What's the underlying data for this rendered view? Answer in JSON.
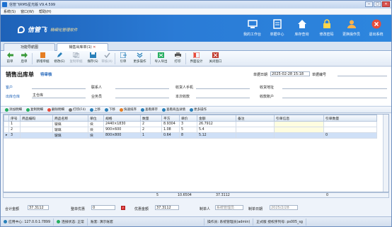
{
  "window": {
    "title": "信管飞RMS星光版 V9.4.599",
    "controls": [
      "─",
      "□",
      "✕"
    ]
  },
  "menu": [
    "系统(S)",
    "窗口(W)",
    "帮助(H)"
  ],
  "brand": {
    "name": "信管飞",
    "slogan": "精细化管理软件"
  },
  "topnav": [
    {
      "label": "我的工作台",
      "icon": "desk-icon",
      "color": "#ffffff"
    },
    {
      "label": "单据中心",
      "icon": "document-icon",
      "color": "#ffffff"
    },
    {
      "label": "库存查询",
      "icon": "home-icon",
      "color": "#ffffff"
    },
    {
      "label": "修改密码",
      "icon": "lock-icon",
      "color": "#ffd54a"
    },
    {
      "label": "更换操作员",
      "icon": "user-icon",
      "color": "#ffb24a"
    },
    {
      "label": "退出系统",
      "icon": "power-icon",
      "color": "#e74c3c"
    }
  ],
  "tabs": [
    {
      "label": "功能导航图"
    },
    {
      "label": "销售出库单(1)",
      "close": "✕"
    }
  ],
  "toolbar": [
    {
      "label": "前单",
      "icon": "arrow-left-icon",
      "color": "#3a9a3a",
      "disabled": false
    },
    {
      "label": "后单",
      "icon": "arrow-right-icon",
      "color": "#3a9a3a",
      "disabled": false
    },
    {
      "label": "新增单据",
      "icon": "new-icon",
      "color": "#e67e22",
      "disabled": false
    },
    {
      "label": "修改(E)",
      "icon": "edit-icon",
      "color": "#2980b9",
      "disabled": false
    },
    {
      "label": "复制单据",
      "icon": "copy-icon",
      "color": "#9aa6b4",
      "disabled": true
    },
    {
      "label": "保存(S)",
      "icon": "save-icon",
      "color": "#2980b9",
      "disabled": false
    },
    {
      "label": "审核(A)",
      "icon": "approve-icon",
      "color": "#9aa6b4",
      "disabled": true
    },
    {
      "label": "引单",
      "icon": "import-icon",
      "color": "#2980b9",
      "disabled": false
    },
    {
      "label": "更多操作",
      "icon": "more-icon",
      "color": "#2980b9",
      "disabled": false
    },
    {
      "label": "导入导出",
      "icon": "excel-icon",
      "color": "#27ae60",
      "disabled": false
    },
    {
      "label": "打印",
      "icon": "print-icon",
      "color": "#555555",
      "disabled": false
    },
    {
      "label": "界面设计",
      "icon": "design-icon",
      "color": "#e74c3c",
      "disabled": false
    },
    {
      "label": "关闭窗口",
      "icon": "close-icon",
      "color": "#c0392b",
      "disabled": false
    }
  ],
  "form": {
    "title": "销售出库单",
    "status": "待审核",
    "date_label": "单据日期",
    "date_value": "2025-02-28 15:18",
    "number_label": "单据编号",
    "number_value": "",
    "customer_label": "客户",
    "contact_label": "联系人",
    "receiver_label": "收货人手机",
    "address_label": "收货地址",
    "warehouse_label": "出库仓库",
    "warehouse_value": "主仓库",
    "salesman_label": "业务员",
    "cost_label": "本次收款",
    "account_label": "收款账户"
  },
  "subtoolbar": [
    {
      "label": "添加明细",
      "icon": "add-icon",
      "color": "#27ae60"
    },
    {
      "label": "复制明细",
      "icon": "copy-row-icon",
      "color": "#27ae60"
    },
    {
      "label": "删除明细",
      "icon": "delete-icon",
      "color": "#e74c3c"
    },
    {
      "label": "打印(F4)",
      "icon": "print-icon",
      "color": "#777777"
    },
    {
      "label": "上移",
      "icon": "up-icon",
      "color": "#2980b9"
    },
    {
      "label": "下移",
      "icon": "down-icon",
      "color": "#2980b9"
    },
    {
      "label": "快速排序",
      "icon": "sort-icon",
      "color": "#e67e22"
    },
    {
      "label": "查看库存",
      "icon": "stock-icon",
      "color": "#2980b9"
    },
    {
      "label": "查看商品详情",
      "icon": "detail-icon",
      "color": "#2980b9"
    },
    {
      "label": "更多操作",
      "icon": "more-icon",
      "color": "#2980b9"
    }
  ],
  "table": {
    "columns": [
      "序号",
      "商品编码",
      "商品名称",
      "单位",
      "规格",
      "数量",
      "平方",
      "单价",
      "金额",
      "备注",
      "引单信息",
      "引单数量"
    ],
    "rows": [
      [
        "1",
        "",
        "玻璃",
        "块",
        "2440×1830",
        "2",
        "8.9304",
        "3",
        "26.7912",
        "",
        "",
        ""
      ],
      [
        "2",
        "",
        "玻璃",
        "块",
        "900×600",
        "2",
        "1.08",
        "5",
        "5.4",
        "",
        "",
        ""
      ],
      [
        "3",
        "",
        "玻璃",
        "块",
        "800×800",
        "1",
        "0.64",
        "8",
        "5.12",
        "",
        "",
        "0"
      ]
    ],
    "totals": {
      "qty": "5",
      "area": "10.6504",
      "amount": "37.3112",
      "ref_qty": "0"
    }
  },
  "footer": {
    "total_label": "合计金额",
    "total_value": "37.3112",
    "discount_label": "整单优惠",
    "discount_value": "0",
    "after_label": "优惠金额",
    "after_value": "37.3112",
    "maker_label": "制单人",
    "maker_value": "系统管理员",
    "makedate_label": "制单日期",
    "makedate_value": "2025/2/28"
  },
  "status": {
    "server": "应用中心: 127.0.0.1:7899",
    "conn": "连接状态: 正常",
    "account": "账套: 演示账套",
    "operator": "操作员: 系统管理员(admin)",
    "license": "正式版 授权序列号: ps005_sg"
  }
}
